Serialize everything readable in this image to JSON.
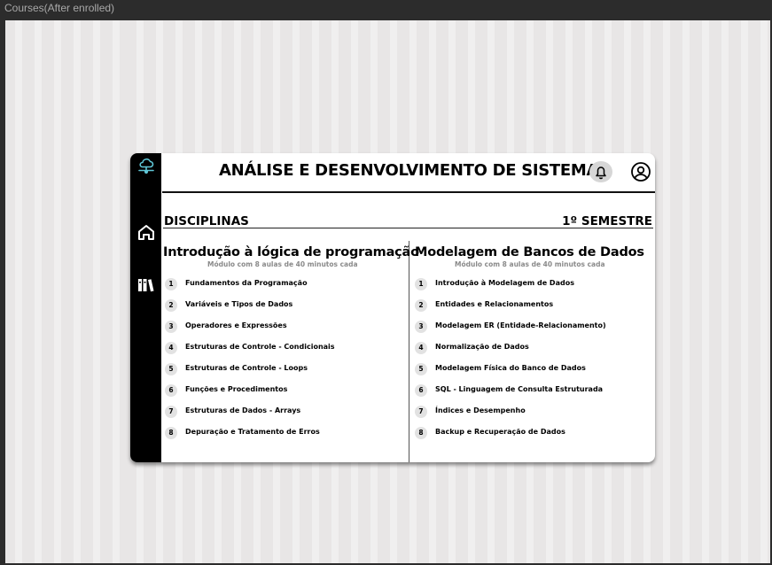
{
  "frame": {
    "label": "Courses(After enrolled)"
  },
  "header": {
    "title": "ANÁLISE E DESENVOLVIMENTO DE SISTEMAS"
  },
  "section": {
    "left": "DISCIPLINAS",
    "right": "1º SEMESTRE"
  },
  "courses": [
    {
      "title": "Introdução à lógica de programação",
      "subtitle": "Módulo com 8 aulas de 40 minutos cada",
      "lessons": [
        {
          "n": "1",
          "label": "Fundamentos da Programação"
        },
        {
          "n": "2",
          "label": "Variáveis e Tipos de Dados"
        },
        {
          "n": "3",
          "label": "Operadores e Expressões"
        },
        {
          "n": "4",
          "label": "Estruturas de Controle - Condicionais"
        },
        {
          "n": "5",
          "label": "Estruturas de Controle - Loops"
        },
        {
          "n": "6",
          "label": "Funções e Procedimentos"
        },
        {
          "n": "7",
          "label": "Estruturas de Dados - Arrays"
        },
        {
          "n": "8",
          "label": "Depuração e Tratamento de Erros"
        }
      ]
    },
    {
      "title": "Modelagem de Bancos de Dados",
      "subtitle": "Módulo com 8 aulas de 40 minutos cada",
      "lessons": [
        {
          "n": "1",
          "label": "Introdução à Modelagem de Dados"
        },
        {
          "n": "2",
          "label": "Entidades e Relacionamentos"
        },
        {
          "n": "3",
          "label": "Modelagem ER (Entidade-Relacionamento)"
        },
        {
          "n": "4",
          "label": "Normalização de Dados"
        },
        {
          "n": "5",
          "label": "Modelagem Física do Banco de Dados"
        },
        {
          "n": "6",
          "label": "SQL - Linguagem de Consulta Estruturada"
        },
        {
          "n": "7",
          "label": "Índices e Desempenho"
        },
        {
          "n": "8",
          "label": "Backup e Recuperação de Dados"
        }
      ]
    }
  ],
  "icons": {
    "logo": "cloud-network-icon",
    "home": "home-icon",
    "library": "library-icon",
    "notifications": "bell-icon",
    "profile": "user-circle-icon",
    "logo_color": "#5fc6d6"
  }
}
